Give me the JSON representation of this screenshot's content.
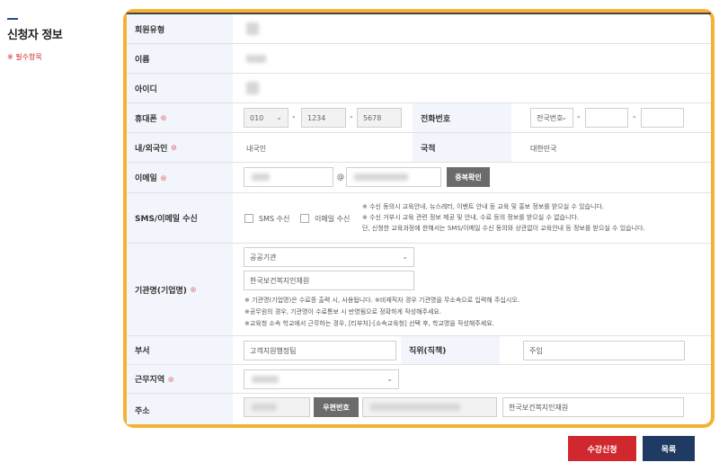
{
  "section": {
    "title": "신청자 정보",
    "required_note": "※ 필수항목"
  },
  "form": {
    "member_type_label": "회원유형",
    "name_label": "이름",
    "id_label": "아이디",
    "mobile_label": "휴대폰",
    "mobile_prefix": "010",
    "mobile_mid": "1234",
    "mobile_last": "5678",
    "phone_label": "전화번호",
    "phone_prefix_placeholder": "전국번호",
    "nationality_type_label": "내/외국인",
    "nationality_type_value": "내국인",
    "nationality_label": "국적",
    "nationality_value": "대한민국",
    "email_label": "이메일",
    "email_check_button": "중복확인",
    "sms_label": "SMS/이메일 수신",
    "sms_option": "SMS 수신",
    "email_option": "이메일 수신",
    "sms_notes": [
      "※ 수신 동의시 교육안내, 뉴스레터, 이벤트 안내 등 교육 및 홍보 정보를 받으실 수 있습니다.",
      "※ 수신 거부시 교육 관련 정보 제공 및 안내, 수료 등의 정보를 받으실 수 없습니다.",
      "단, 신청한 교육과정에 한해서는 SMS/이메일 수신 동의와 상관없이 교육안내 등 정보를 받으실 수 있습니다."
    ],
    "org_label": "기관명(기업명)",
    "org_type_value": "공공기관",
    "org_name_value": "한국보건복지인재원",
    "org_notes": [
      "※ 기관명(기업명)은 수료증 출력 시, 사용됩니다. ※비재직자 경우 기관명을 무소속으로 입력해 주십시오.",
      "※공무원의 경우, 기관명이 수료통보 시 반영됨으로 정확하게 작성해주세요.",
      "※교육청 소속 학교에서 근무하는 경우, [티부처]-[소속교육청] 선택 후, 학교명을 작성해주세요."
    ],
    "dept_label": "부서",
    "dept_value": "고객지원행정팀",
    "position_label": "직위(직책)",
    "position_value": "주임",
    "region_label": "근무지역",
    "address_label": "주소",
    "zip_button": "우편번호",
    "address_detail_value": "한국보건복지인재원"
  },
  "actions": {
    "submit": "수강신청",
    "list": "목록"
  },
  "colors": {
    "accent_red": "#d0282e",
    "navy": "#1f3a63",
    "highlight": "#f4b234"
  }
}
